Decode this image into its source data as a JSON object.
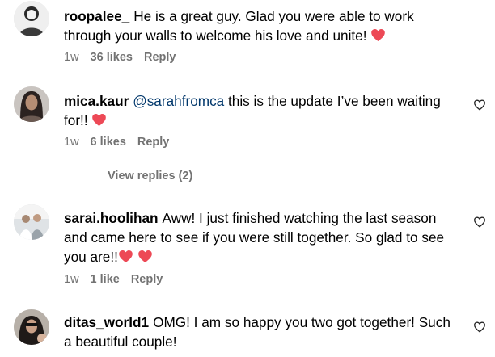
{
  "colors": {
    "heart": "#ed4956",
    "meta": "#737373",
    "mention": "#00376b"
  },
  "comments": [
    {
      "username": "roopalee_",
      "text": "He is a great guy. Glad you were able to work through your walls to welcome his love and unite!",
      "hearts": 1,
      "time": "1w",
      "likes": "36 likes",
      "reply": "Reply"
    },
    {
      "username": "mica.kaur",
      "mention": "@sarahfromca",
      "text": "this is the update I’ve been waiting for!!",
      "hearts": 1,
      "time": "1w",
      "likes": "6 likes",
      "reply": "Reply",
      "view_replies": "View replies (2)"
    },
    {
      "username": "sarai.hoolihan",
      "text": "Aww! I just finished watching the last season and came here to see if you were still together. So glad to see you are!!",
      "hearts": 2,
      "time": "1w",
      "likes": "1 like",
      "reply": "Reply"
    },
    {
      "username": "ditas_world1",
      "text": "OMG! I am so happy you two got together! Such a beautiful couple!",
      "hearts": 0
    }
  ]
}
